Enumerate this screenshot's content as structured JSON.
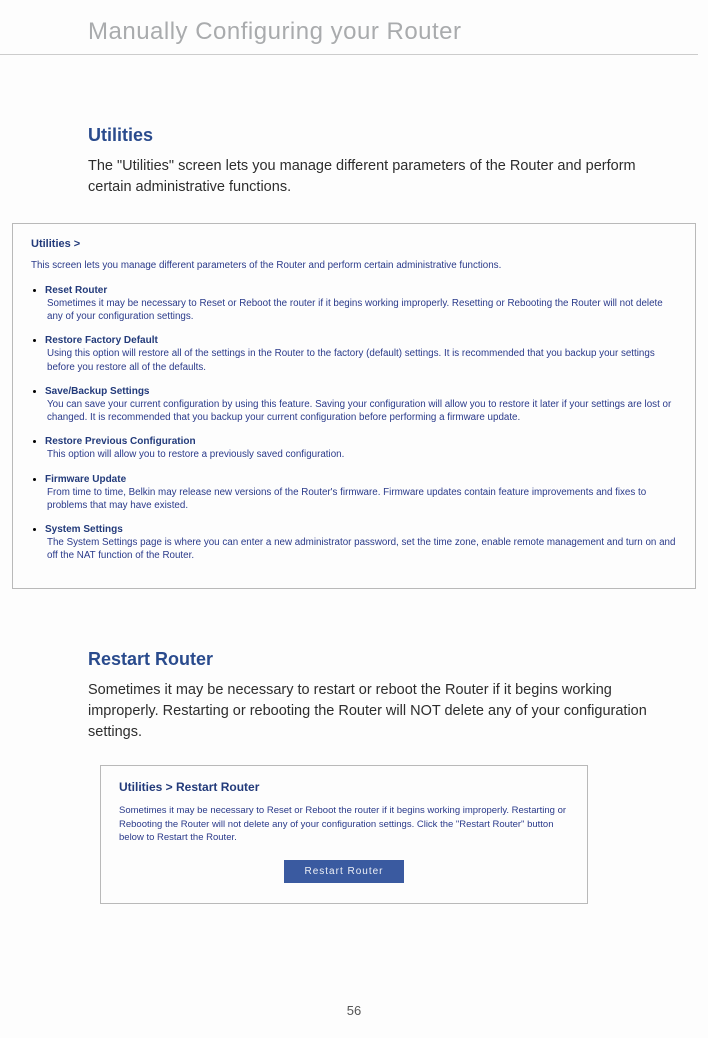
{
  "header": {
    "title": "Manually Configuring your Router"
  },
  "utilities": {
    "heading": "Utilities",
    "body": "The \"Utilities\" screen lets you manage different parameters of the Router and perform certain administrative functions.",
    "box": {
      "title": "Utilities >",
      "intro": "This screen lets you manage different parameters of the Router and perform certain administrative functions.",
      "items": [
        {
          "title": "Reset Router",
          "desc": "Sometimes it may be necessary to Reset or Reboot the router if it begins working improperly. Resetting or Rebooting the Router will not delete any of your configuration settings."
        },
        {
          "title": "Restore Factory Default",
          "desc": "Using this option will restore all of the settings in the Router to the factory (default) settings. It is recommended that you backup your settings before you restore all of the defaults."
        },
        {
          "title": "Save/Backup Settings",
          "desc": "You can save your current configuration by using this feature. Saving your configuration will allow you to restore it later if your settings are lost or changed. It is recommended that you backup your current configuration before performing a firmware update."
        },
        {
          "title": "Restore Previous Configuration",
          "desc": "This option will allow you to restore a previously saved configuration."
        },
        {
          "title": "Firmware Update",
          "desc": "From time to time, Belkin may release new versions of the Router's firmware. Firmware updates contain feature improvements and fixes to problems that may have existed."
        },
        {
          "title": "System Settings",
          "desc": "The System Settings page is where you can enter a new administrator password, set the time zone, enable remote management and turn on and off the NAT function of the Router."
        }
      ]
    }
  },
  "restart": {
    "heading": "Restart Router",
    "body": "Sometimes it may be necessary to restart or reboot the Router if it begins working improperly. Restarting or rebooting the Router will NOT delete any of your configuration settings.",
    "box": {
      "title": "Utilities > Restart Router",
      "desc": "Sometimes it may be necessary to Reset or Reboot the router if it begins working improperly. Restarting or Rebooting the Router will not delete any of your configuration settings. Click the \"Restart Router\" button below to Restart the Router.",
      "button": "Restart Router"
    }
  },
  "page_number": "56"
}
